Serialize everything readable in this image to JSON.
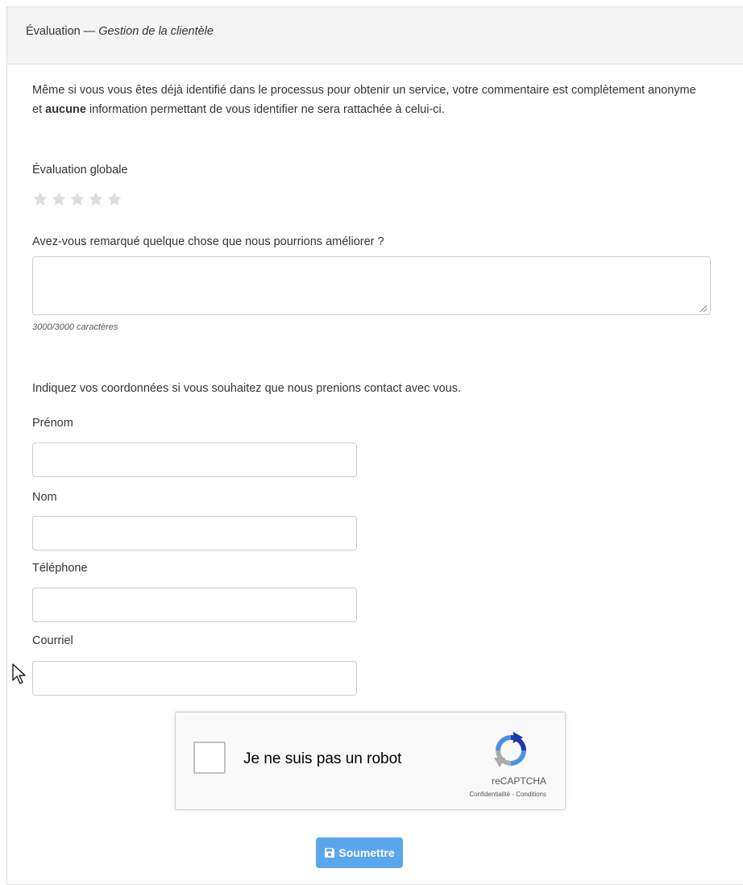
{
  "header": {
    "title": "Évaluation",
    "separator": " — ",
    "subtitle": "Gestion de la clientèle"
  },
  "intro": {
    "part1": "Même si vous vous êtes déjà identifié dans le processus pour obtenir un service, votre commentaire est complètement anonyme et ",
    "bold": "aucune",
    "part2": " information permettant de vous identifier ne sera rattachée à celui-ci."
  },
  "rating": {
    "label": "Évaluation globale",
    "value": 0,
    "max": 5,
    "empty_color": "#dddddd"
  },
  "improvement": {
    "label": "Avez-vous remarqué quelque chose que nous pourrions améliorer ?",
    "value": "",
    "counter": "3000/3000 caractères"
  },
  "contact": {
    "prompt": "Indiquez vos coordonnées si vous souhaitez que nous prenions contact avec vous.",
    "fields": [
      {
        "label": "Prénom",
        "value": ""
      },
      {
        "label": "Nom",
        "value": ""
      },
      {
        "label": "Téléphone",
        "value": ""
      },
      {
        "label": "Courriel",
        "value": ""
      }
    ]
  },
  "captcha": {
    "checkbox_label": "Je ne suis pas un robot",
    "brand": "reCAPTCHA",
    "privacy": "Confidentialité",
    "links_separator": " - ",
    "terms": "Conditions",
    "checked": false
  },
  "submit": {
    "label": "Soumettre",
    "icon": "save-icon",
    "color": "#5aa6ec"
  },
  "colors": {
    "header_bg": "#f5f5f5",
    "border": "#dddddd",
    "text": "#333333"
  }
}
